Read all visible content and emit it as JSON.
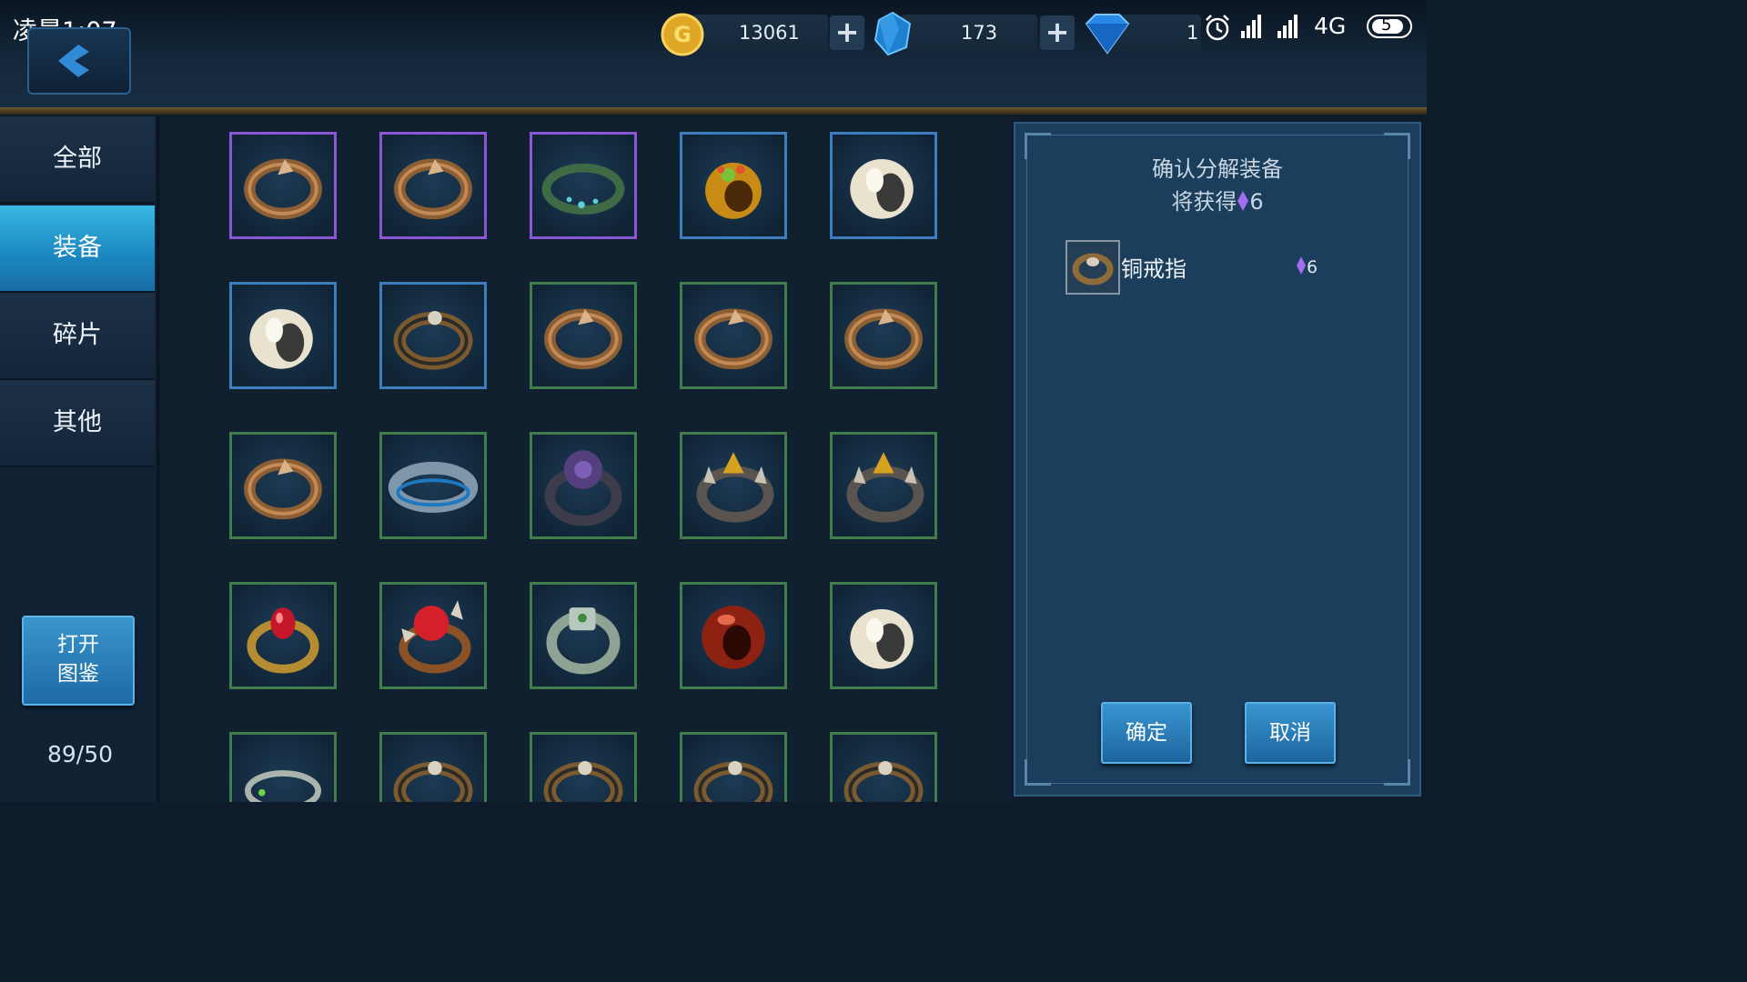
{
  "status_bar": {
    "time": "凌晨1:07",
    "network": "4G",
    "battery": "5"
  },
  "currency": {
    "gold": "13061",
    "crystal": "173",
    "diamond": "1",
    "plus": "+"
  },
  "tabs": [
    {
      "label": "全部",
      "active": false
    },
    {
      "label": "装备",
      "active": true
    },
    {
      "label": "碎片",
      "active": false
    },
    {
      "label": "其他",
      "active": false
    }
  ],
  "codex_button": {
    "line1": "打开",
    "line2": "图鉴"
  },
  "capacity": "89/50",
  "grid": [
    [
      "purple",
      "copper"
    ],
    [
      "purple",
      "copper"
    ],
    [
      "purple",
      "jade"
    ],
    [
      "blue",
      "gold"
    ],
    [
      "blue",
      "ivory"
    ],
    [
      "blue",
      "ivory"
    ],
    [
      "blue",
      "bronze"
    ],
    [
      "green",
      "copper"
    ],
    [
      "green",
      "copper"
    ],
    [
      "green",
      "copper"
    ],
    [
      "green",
      "copper"
    ],
    [
      "green",
      "silver"
    ],
    [
      "green",
      "demon"
    ],
    [
      "green",
      "spike"
    ],
    [
      "green",
      "spike"
    ],
    [
      "green",
      "ruby"
    ],
    [
      "green",
      "redspike"
    ],
    [
      "green",
      "signet"
    ],
    [
      "green",
      "crimson"
    ],
    [
      "green",
      "ivory"
    ],
    [
      "green",
      "silverthin"
    ],
    [
      "green",
      "bronze"
    ],
    [
      "green",
      "bronze"
    ],
    [
      "green",
      "bronze"
    ],
    [
      "green",
      "bronze"
    ]
  ],
  "panel": {
    "title_line1": "确认分解装备",
    "title_line2_prefix": "将获得",
    "title_line2_amount": "6",
    "item_name": "铜戒指",
    "item_value": "6",
    "confirm_label": "确定",
    "cancel_label": "取消"
  },
  "colors": {
    "accent": "#1f8cc9",
    "gold": "#c9a13a",
    "gem": "#a36df0"
  }
}
